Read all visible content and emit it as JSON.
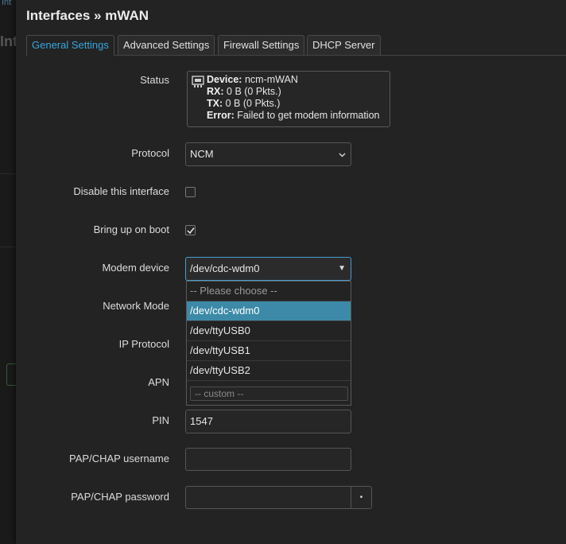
{
  "background": {
    "crumb": "Int",
    "big_text": "Int"
  },
  "modal": {
    "title": "Interfaces » mWAN",
    "tabs": [
      {
        "label": "General Settings",
        "active": true
      },
      {
        "label": "Advanced Settings",
        "active": false
      },
      {
        "label": "Firewall Settings",
        "active": false
      },
      {
        "label": "DHCP Server",
        "active": false
      }
    ]
  },
  "status": {
    "label": "Status",
    "device_key": "Device:",
    "device_val": "ncm-mWAN",
    "rx_key": "RX:",
    "rx_val": "0 B (0 Pkts.)",
    "tx_key": "TX:",
    "tx_val": "0 B (0 Pkts.)",
    "error_key": "Error:",
    "error_val": "Failed to get modem information",
    "icon": "ethernet-port-icon"
  },
  "protocol": {
    "label": "Protocol",
    "value": "NCM"
  },
  "disable": {
    "label": "Disable this interface",
    "checked": false
  },
  "boot": {
    "label": "Bring up on boot",
    "checked": true
  },
  "modem": {
    "label": "Modem device",
    "value": "/dev/cdc-wdm0",
    "options": [
      {
        "label": "-- Please choose --",
        "placeholder": true
      },
      {
        "label": "/dev/cdc-wdm0",
        "selected": true
      },
      {
        "label": "/dev/ttyUSB0"
      },
      {
        "label": "/dev/ttyUSB1"
      },
      {
        "label": "/dev/ttyUSB2"
      }
    ],
    "custom_placeholder": "-- custom --"
  },
  "network_mode": {
    "label": "Network Mode"
  },
  "ip_protocol": {
    "label": "IP Protocol"
  },
  "apn": {
    "label": "APN"
  },
  "pin": {
    "label": "PIN",
    "value": "1547"
  },
  "pap_user": {
    "label": "PAP/CHAP username",
    "value": ""
  },
  "pap_pass": {
    "label": "PAP/CHAP password",
    "value": "",
    "reveal_glyph": "•"
  },
  "colors": {
    "accent": "#37a5dd",
    "selected_option": "#3c8aa7",
    "focus_border": "#4a9cd0"
  }
}
